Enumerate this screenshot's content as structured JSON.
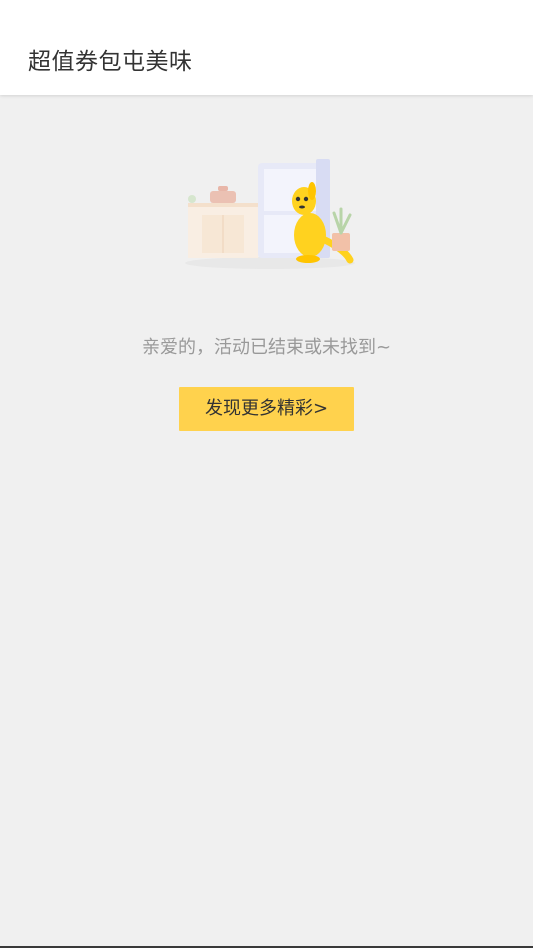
{
  "header": {
    "title": "超值券包屯美味"
  },
  "empty_state": {
    "illustration_icon": "kangaroo-fridge-illustration",
    "message": "亲爱的，活动已结束或未找到~",
    "button_label": "发现更多精彩>"
  },
  "colors": {
    "accent": "#ffd24d",
    "background": "#f0f0f0",
    "message_text": "#999999"
  }
}
